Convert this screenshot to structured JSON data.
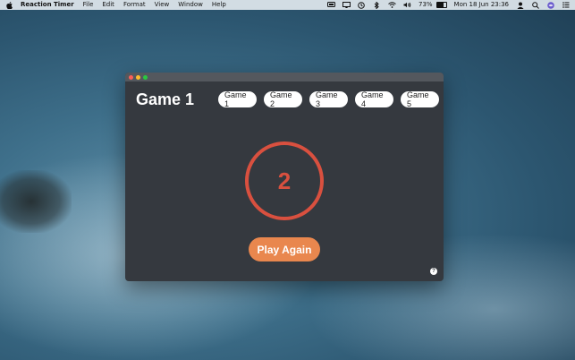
{
  "menubar": {
    "app_name": "Reaction Timer",
    "items": [
      "File",
      "Edit",
      "Format",
      "View",
      "Window",
      "Help"
    ],
    "status": {
      "battery_percent": "73%",
      "battery_level": 0.73,
      "datetime": "Mon 18 Jun  23:36"
    },
    "icons": [
      "apple-icon",
      "airplay-display-icon",
      "screen-mirror-icon",
      "time-machine-icon",
      "bluetooth-icon",
      "wifi-icon",
      "volume-icon",
      "battery-icon",
      "user-icon",
      "spotlight-search-icon",
      "siri-icon",
      "notification-center-icon"
    ]
  },
  "window": {
    "title": "Game 1",
    "tabs": [
      {
        "label": "Game 1"
      },
      {
        "label": "Game 2"
      },
      {
        "label": "Game 3"
      },
      {
        "label": "Game 4"
      },
      {
        "label": "Game 5"
      }
    ],
    "countdown_value": "2",
    "play_again_label": "Play Again",
    "help_label": "?"
  },
  "colors": {
    "window_bg": "#35393f",
    "accent_red": "#d9503f",
    "accent_orange": "#e9874e",
    "close": "#fc5f57",
    "minimize": "#fdbc2e",
    "zoom": "#28c840"
  }
}
